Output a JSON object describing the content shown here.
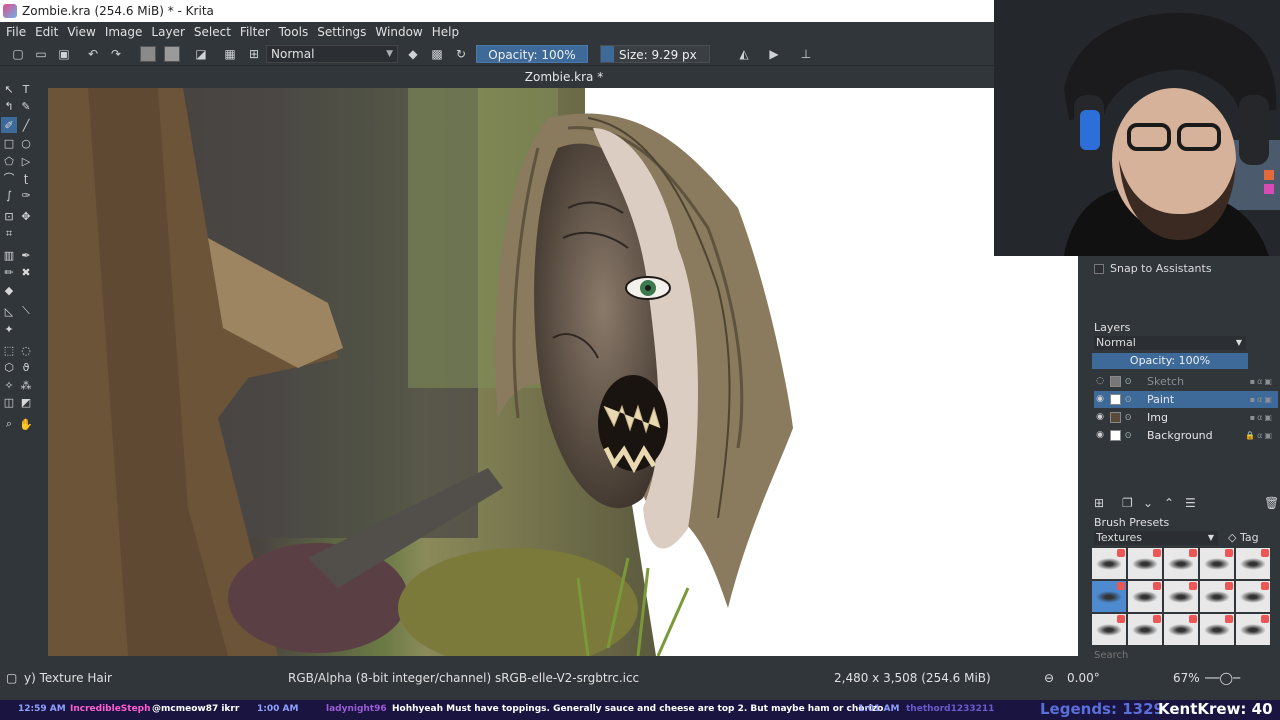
{
  "window": {
    "title": "Zombie.kra (254.6 MiB)  * - Krita",
    "close_glyph": "✕"
  },
  "menu": [
    "File",
    "Edit",
    "View",
    "Image",
    "Layer",
    "Select",
    "Filter",
    "Tools",
    "Settings",
    "Window",
    "Help"
  ],
  "toolbar": {
    "blend_mode": "Normal",
    "opacity": "Opacity: 100%",
    "size": "Size: 9.29 px",
    "size_fraction": 0.12,
    "fg_color": "#8a8a8a",
    "bg_color": "#9a9a9a"
  },
  "document": {
    "tab_title": "Zombie.kra *"
  },
  "dockers": {
    "snap_label": "Snap to Assistants",
    "layers": {
      "title": "Layers",
      "blend_mode": "Normal",
      "opacity": "Opacity:  100%",
      "items": [
        {
          "name": "Sketch",
          "visible": false,
          "selected": false
        },
        {
          "name": "Paint",
          "visible": true,
          "selected": true
        },
        {
          "name": "Img",
          "visible": true,
          "selected": false
        },
        {
          "name": "Background",
          "visible": true,
          "selected": false,
          "locked": true
        }
      ]
    },
    "brush_presets": {
      "title": "Brush Presets",
      "filter": "Textures",
      "tag_label": "Tag",
      "search_placeholder": "Search"
    }
  },
  "status": {
    "brush": "y) Texture Hair",
    "color_space": "RGB/Alpha (8-bit integer/channel)  sRGB-elle-V2-srgbtrc.icc",
    "dimensions": "2,480 x 3,508 (254.6 MiB)",
    "rotation": "0.00°",
    "zoom": "67%"
  },
  "ticker": {
    "items": [
      {
        "text": "12:59 AM",
        "color": "#8fa0ff"
      },
      {
        "text": "IncredibleSteph",
        "color": "#ff5fd0"
      },
      {
        "text": "@mcmeow87 ikrr",
        "color": "#ffffff"
      },
      {
        "text": "1:00 AM",
        "color": "#8fa0ff"
      },
      {
        "text": "ladynight96",
        "color": "#9b5bd6"
      },
      {
        "text": "Hohhyeah  Must have toppings. Generally sauce and cheese are top 2. But maybe ham or chorizo",
        "color": "#ffffff"
      },
      {
        "text": "1:01 AM",
        "color": "#8fa0ff"
      },
      {
        "text": "thethord1233211",
        "color": "#6a5acd"
      }
    ],
    "legends": "Legends: 1329",
    "brand": "KentKrew: 40"
  }
}
